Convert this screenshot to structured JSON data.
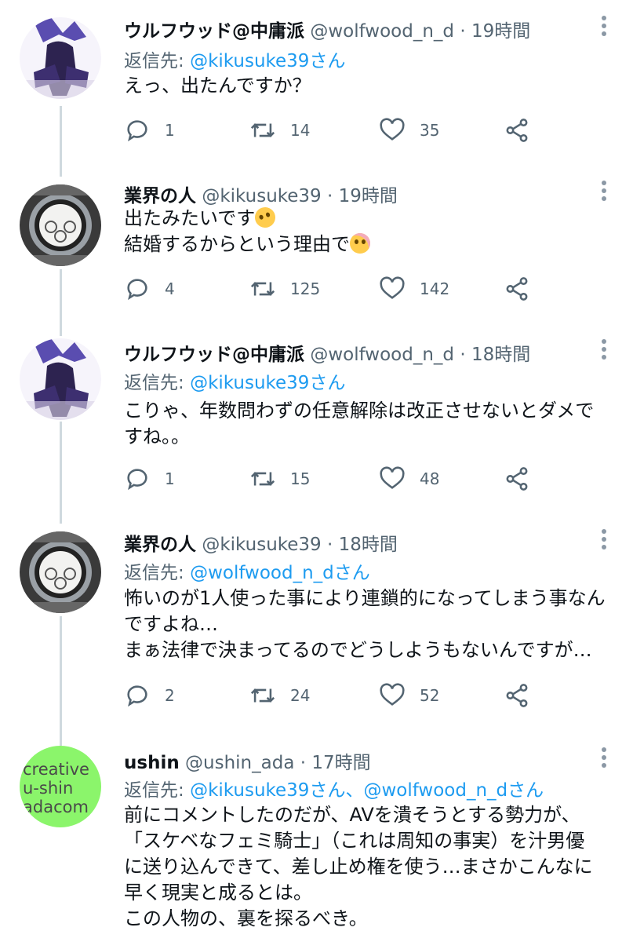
{
  "tweets": [
    {
      "name": "ウルフウッド@中庸派",
      "handle": "@wolfwood_n_d",
      "time": "19時間",
      "reply_label": "返信先:",
      "reply_mentions": "@kikusuke39さん",
      "lines": [
        "えっ、出たんですか？"
      ],
      "replies": "1",
      "retweets": "14",
      "likes": "35"
    },
    {
      "name": "業界の人",
      "handle": "@kikusuke39",
      "time": "19時間",
      "lines": [
        "出たみたいです",
        "結婚するからという理由で"
      ],
      "replies": "4",
      "retweets": "125",
      "likes": "142"
    },
    {
      "name": "ウルフウッド@中庸派",
      "handle": "@wolfwood_n_d",
      "time": "18時間",
      "reply_label": "返信先:",
      "reply_mentions": "@kikusuke39さん",
      "lines": [
        "こりゃ、年数問わずの任意解除は改正させないとダメで",
        "すね。。"
      ],
      "replies": "1",
      "retweets": "15",
      "likes": "48"
    },
    {
      "name": "業界の人",
      "handle": "@kikusuke39",
      "time": "18時間",
      "reply_label": "返信先:",
      "reply_mentions": "@wolfwood_n_dさん",
      "lines": [
        "怖いのが1人使った事により連鎖的になってしまう事なん",
        "ですよね…",
        "まぁ法律で決まってるのでどうしようもないんですが…"
      ],
      "replies": "2",
      "retweets": "24",
      "likes": "52"
    },
    {
      "name": "ushin",
      "handle": "@ushin_ada",
      "time": "17時間",
      "reply_label": "返信先:",
      "reply_mentions": "@kikusuke39さん、@wolfwood_n_dさん",
      "lines": [
        "前にコメントしたのだが、AVを潰そうとする勢力が、",
        "「スケベなフェミ騎士」（これは周知の事実）を汁男優",
        "に送り込んできて、差し止め権を使う…まさかこんなに",
        "早く現実と成るとは。",
        "この人物の、裏を探るべき。"
      ]
    }
  ],
  "avatar_text_ushin": [
    "creative",
    "u-shin",
    "adacom"
  ],
  "dot": "·",
  "colors": {
    "accent": "#1d9bf0",
    "muted": "#536471",
    "line": "#cfd9de",
    "ushin_avatar": "#8bf56b"
  }
}
